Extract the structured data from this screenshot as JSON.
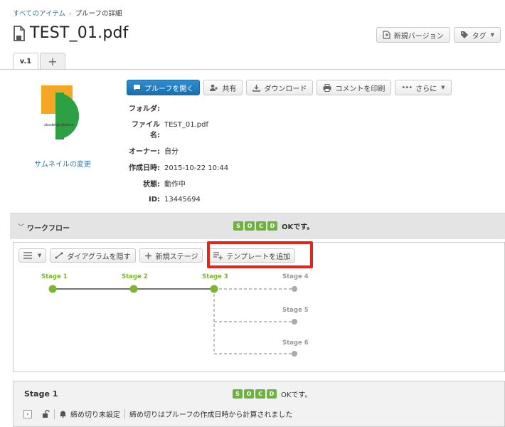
{
  "breadcrumb": {
    "root": "すべてのアイテム",
    "current": "プルーフの詳細"
  },
  "page": {
    "title": "TEST_01.pdf"
  },
  "top_buttons": {
    "new_version": "新規バージョン",
    "tag": "タグ"
  },
  "tabs": [
    {
      "label": "v.1"
    },
    {
      "label": "+"
    }
  ],
  "thumbnail": {
    "caption": "abcdefghijklmno",
    "change_link": "サムネイルの変更"
  },
  "actions": {
    "open_proof": "プルーフを開く",
    "share": "共有",
    "download": "ダウンロード",
    "print_comments": "コメントを印刷",
    "more": "さらに"
  },
  "meta": [
    {
      "label": "フォルダ:",
      "value": ""
    },
    {
      "label": "ファイル名:",
      "value": "TEST_01.pdf"
    },
    {
      "label": "オーナー:",
      "value": "自分"
    },
    {
      "label": "作成日時:",
      "value": "2015-10-22 10:44"
    },
    {
      "label": "状態:",
      "value": "動作中"
    },
    {
      "label": "ID:",
      "value": "13445694"
    }
  ],
  "workflow": {
    "title": "ワークフロー",
    "badges": [
      "S",
      "O",
      "C",
      "D"
    ],
    "status": "OKです。",
    "toolbar": {
      "hide_diagram": "ダイアグラムを隠す",
      "new_stage": "新規ステージ",
      "add_template": "テンプレートを追加"
    },
    "stages": [
      "Stage 1",
      "Stage 2",
      "Stage 3",
      "Stage 4",
      "Stage 5",
      "Stage 6"
    ]
  },
  "stage_panel": {
    "title": "Stage 1",
    "badges": [
      "S",
      "O",
      "C",
      "D"
    ],
    "status": "OKです。",
    "deadline_unset": "締め切り未設定",
    "deadline_note": "締め切りはプルーフの作成日時から計算されました"
  },
  "colors": {
    "accent": "#6cb33e",
    "primary": "#1f7ec2",
    "highlight": "#e3261c",
    "link": "#2a7ab0"
  }
}
